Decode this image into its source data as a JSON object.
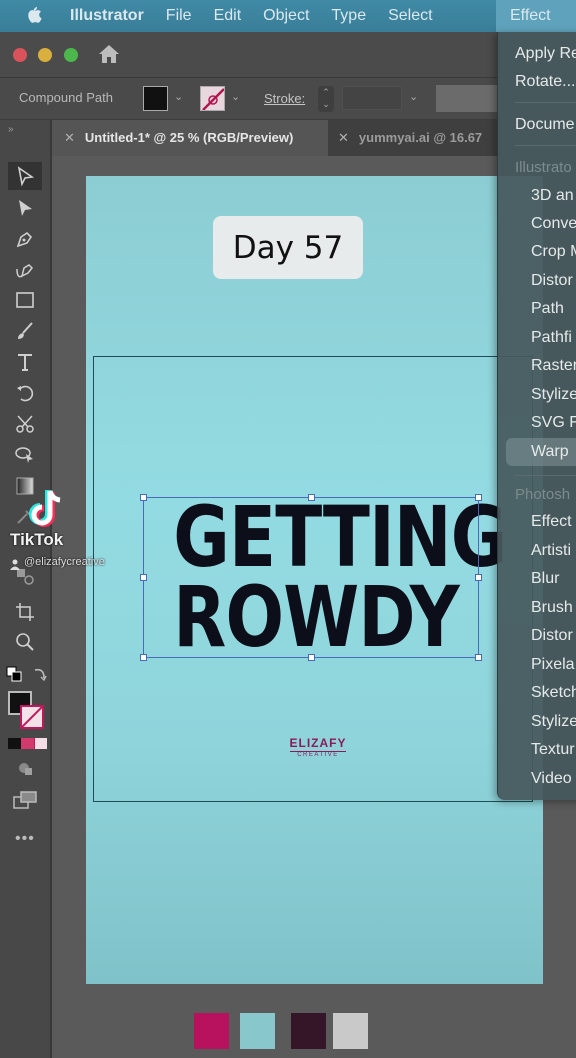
{
  "menubar": {
    "apple_icon": "apple-icon",
    "items": [
      "Illustrator",
      "File",
      "Edit",
      "Object",
      "Type",
      "Select",
      "Effect"
    ],
    "active": "Effect"
  },
  "window": {
    "controls": [
      "close",
      "minimize",
      "zoom"
    ],
    "home_icon": "home-icon"
  },
  "control_bar": {
    "selection_label": "Compound Path",
    "fill_color": "#111111",
    "stroke_color": "none",
    "stroke_label": "Stroke:",
    "stroke_value": ""
  },
  "tabs": [
    {
      "label": "Untitled-1* @ 25 % (RGB/Preview)",
      "active": true
    },
    {
      "label": "yummyai.ai @ 16.67",
      "active": false
    }
  ],
  "tools": [
    "selection-tool",
    "direct-selection-tool",
    "pen-tool",
    "curvature-tool",
    "rectangle-tool",
    "paintbrush-tool",
    "type-tool",
    "rotate-tool",
    "scissors-tool",
    "shape-builder-tool",
    "gradient-tool",
    "eyedropper-tool",
    "blend-tool",
    "artboard-tool",
    "zoom-tool"
  ],
  "toolbar_bottom": {
    "fill_color": "#111111",
    "stroke_color": "none",
    "more_label": "•••"
  },
  "artboard": {
    "day_badge": "Day 57",
    "headline_line1": "GETTING",
    "headline_line2": "ROWDY",
    "logo_name": "ELIZAFY",
    "logo_sub": "CREATIVE",
    "background_color": "#93dbe2"
  },
  "palette_swatches": [
    "#b8125f",
    "#88c7cc",
    "#341628",
    "#c9c9c9"
  ],
  "effect_menu": {
    "top_items": [
      "Apply Re",
      "Rotate...",
      "Docume"
    ],
    "illustrator_header": "Illustrato",
    "illustrator_items": [
      "3D an",
      "Conve",
      "Crop M",
      "Distor",
      "Path",
      "Pathfi",
      "Raster",
      "Stylize",
      "SVG F",
      "Warp"
    ],
    "highlighted": "Warp",
    "photoshop_header": "Photosh",
    "photoshop_items": [
      "Effect",
      "Artisti",
      "Blur",
      "Brush",
      "Distor",
      "Pixela",
      "Sketch",
      "Stylize",
      "Textur",
      "Video"
    ]
  },
  "overlay": {
    "brand": "TikTok",
    "handle": "@elizafycreative"
  }
}
